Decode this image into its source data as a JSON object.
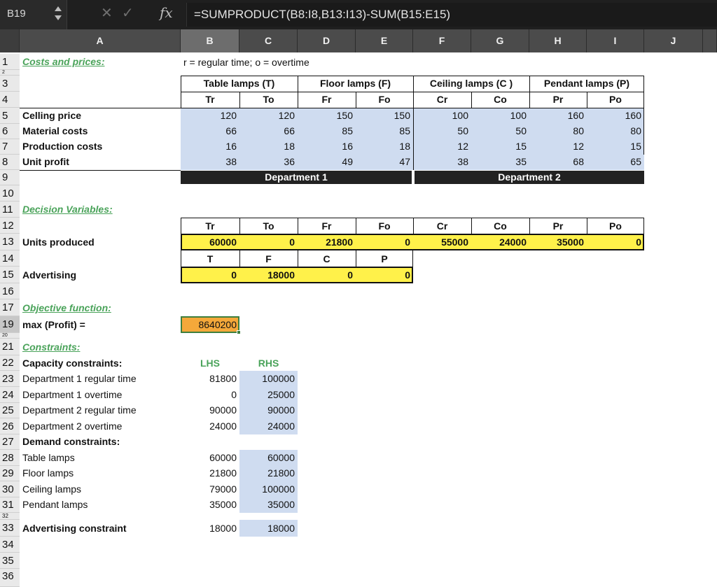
{
  "formula_bar": {
    "name_box": "B19",
    "cancel_glyph": "✕",
    "enter_glyph": "✓",
    "fx_label": "fx",
    "formula": "=SUMPRODUCT(B8:I8,B13:I13)-SUM(B15:E15)"
  },
  "columns": [
    "A",
    "B",
    "C",
    "D",
    "E",
    "F",
    "G",
    "H",
    "I",
    "J"
  ],
  "rows": [
    "1",
    "2",
    "3",
    "4",
    "5",
    "6",
    "7",
    "8",
    "9",
    "10",
    "11",
    "12",
    "13",
    "14",
    "15",
    "16",
    "17",
    "19",
    "20",
    "21",
    "22",
    "23",
    "24",
    "25",
    "26",
    "27",
    "28",
    "29",
    "30",
    "31",
    "32",
    "33",
    "34",
    "35",
    "36"
  ],
  "sheet": {
    "a1": "Costs and prices:",
    "b1": "r = regular time; o = overtime",
    "groups": [
      "Table lamps (T)",
      "Floor lamps (F)",
      "Ceiling lamps (C )",
      "Pendant lamps (P)"
    ],
    "subheads": [
      "Tr",
      "To",
      "Fr",
      "Fo",
      "Cr",
      "Co",
      "Pr",
      "Po"
    ],
    "price_rows": [
      {
        "label": "Celling price",
        "values": [
          "120",
          "120",
          "150",
          "150",
          "100",
          "100",
          "160",
          "160"
        ]
      },
      {
        "label": "Material costs",
        "values": [
          "66",
          "66",
          "85",
          "85",
          "50",
          "50",
          "80",
          "80"
        ]
      },
      {
        "label": "Production costs",
        "values": [
          "16",
          "18",
          "16",
          "18",
          "12",
          "15",
          "12",
          "15"
        ]
      },
      {
        "label": "Unit profit",
        "values": [
          "38",
          "36",
          "49",
          "47",
          "38",
          "35",
          "68",
          "65"
        ]
      }
    ],
    "dept1": "Department 1",
    "dept2": "Department 2",
    "decision_title": "Decision Variables:",
    "decision_heads": [
      "Tr",
      "To",
      "Fr",
      "Fo",
      "Cr",
      "Co",
      "Pr",
      "Po"
    ],
    "units_label": "Units produced",
    "units": [
      "60000",
      "0",
      "21800",
      "0",
      "55000",
      "24000",
      "35000",
      "0"
    ],
    "adv_heads": [
      "T",
      "F",
      "C",
      "P"
    ],
    "adv_label": "Advertising",
    "adv_values": [
      "0",
      "18000",
      "0",
      "0"
    ],
    "objective_title": "Objective function:",
    "objective_label": "max (Profit) =",
    "objective_value": "8640200",
    "constraints_title": "Constraints:",
    "lhs_head": "LHS",
    "rhs_head": "RHS",
    "capacity_head": "Capacity constraints:",
    "capacity": [
      {
        "label": "Department 1 regular time",
        "lhs": "81800",
        "rhs": "100000"
      },
      {
        "label": "Department 1 overtime",
        "lhs": "0",
        "rhs": "25000"
      },
      {
        "label": "Department 2 regular time",
        "lhs": "90000",
        "rhs": "90000"
      },
      {
        "label": "Department 2 overtime",
        "lhs": "24000",
        "rhs": "24000"
      }
    ],
    "demand_head": "Demand constraints:",
    "demand": [
      {
        "label": "Table lamps",
        "lhs": "60000",
        "rhs": "60000"
      },
      {
        "label": "Floor lamps",
        "lhs": "21800",
        "rhs": "21800"
      },
      {
        "label": "Ceiling lamps",
        "lhs": "79000",
        "rhs": "100000"
      },
      {
        "label": "Pendant lamps",
        "lhs": "35000",
        "rhs": "35000"
      }
    ],
    "adv_constraint_label": "Advertising constraint",
    "adv_constraint_lhs": "18000",
    "adv_constraint_rhs": "18000"
  },
  "colors": {
    "input_blue": "#cfdcf0",
    "decision_yellow": "#fff14a",
    "objective_orange": "#f4a83a",
    "section_green": "#4aa35a",
    "dept_bar": "#222222"
  }
}
